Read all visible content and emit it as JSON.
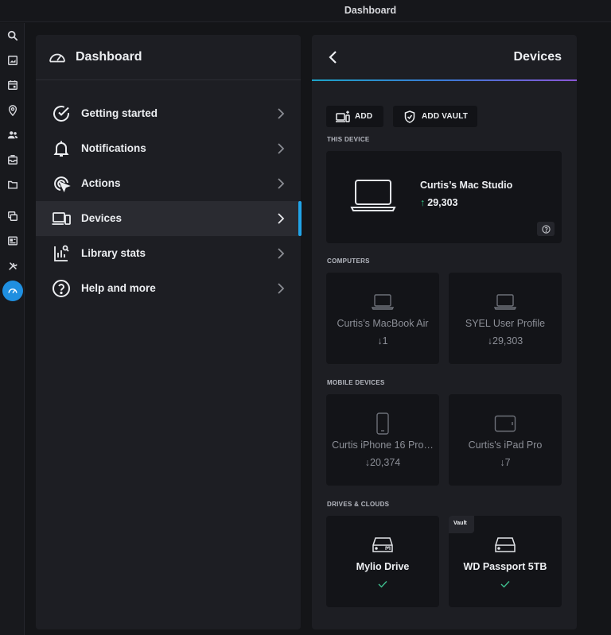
{
  "window": {
    "title": "Dashboard"
  },
  "rail": {
    "icons": [
      "search-icon",
      "image-icon",
      "calendar-icon",
      "map-pin-icon",
      "people-icon",
      "inbox-icon",
      "folder-icon",
      "duplicate-icon",
      "card-icon",
      "tools-icon",
      "dashboard-icon"
    ],
    "active": "dashboard-icon",
    "accent_color": "#1f8fe0"
  },
  "left_panel": {
    "title": "Dashboard",
    "menu": [
      {
        "label": "Getting started",
        "icon": "check-circle-icon"
      },
      {
        "label": "Notifications",
        "icon": "bell-icon"
      },
      {
        "label": "Actions",
        "icon": "cursor-click-icon"
      },
      {
        "label": "Devices",
        "icon": "devices-icon",
        "selected": true
      },
      {
        "label": "Library stats",
        "icon": "stats-icon"
      },
      {
        "label": "Help and more",
        "icon": "help-circle-icon"
      }
    ],
    "selection_color": "#21a4e8"
  },
  "right_panel": {
    "title": "Devices",
    "buttons": {
      "add": "ADD",
      "add_vault": "ADD VAULT"
    },
    "this_device": {
      "heading": "THIS DEVICE",
      "name": "Curtis’s Mac Studio",
      "count": "29,303",
      "direction": "up"
    },
    "computers": {
      "heading": "COMPUTERS",
      "items": [
        {
          "name": "Curtis’s MacBook Air",
          "count": "1",
          "direction": "down"
        },
        {
          "name": "SYEL User Profile",
          "count": "29,303",
          "direction": "down"
        }
      ]
    },
    "mobile": {
      "heading": "MOBILE DEVICES",
      "items": [
        {
          "name": "Curtis iPhone 16 Pro…",
          "count": "20,374",
          "direction": "down"
        },
        {
          "name": "Curtis's iPad Pro",
          "count": "7",
          "direction": "down"
        }
      ]
    },
    "drives": {
      "heading": "DRIVES & CLOUDS",
      "items": [
        {
          "name": "Mylio Drive",
          "status": "synced"
        },
        {
          "name": "WD Passport 5TB",
          "badge": "Vault",
          "status": "synced"
        }
      ]
    },
    "arrows": {
      "up": "↑",
      "down": "↓"
    },
    "colors": {
      "up_arrow": "#35c98a",
      "check": "#3fbf8f"
    }
  }
}
